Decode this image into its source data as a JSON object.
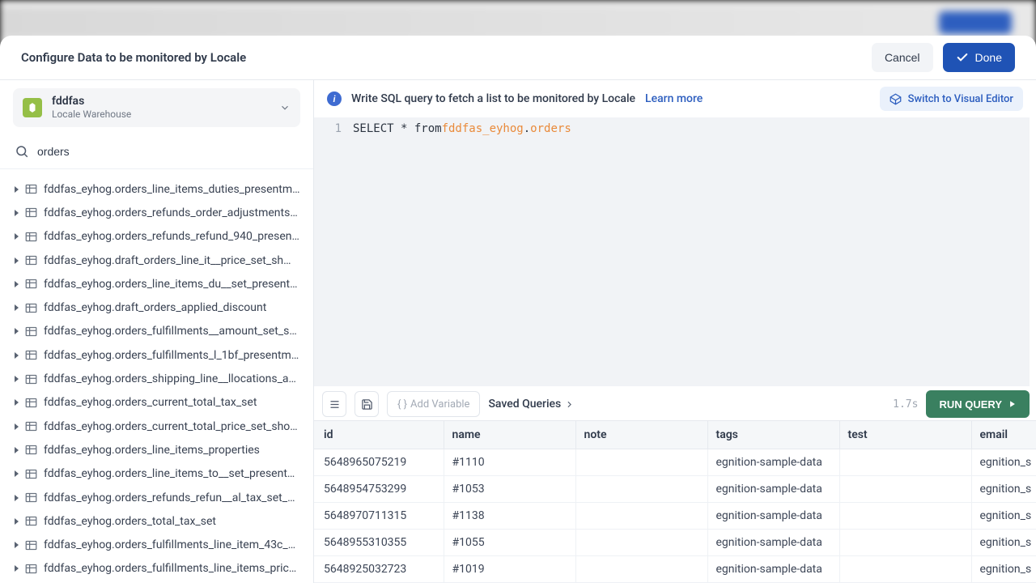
{
  "modal": {
    "title": "Configure Data to be monitored by Locale",
    "cancel": "Cancel",
    "done": "Done"
  },
  "source": {
    "name": "fddfas",
    "subtitle": "Locale Warehouse"
  },
  "search": {
    "value": "orders"
  },
  "tables": [
    "fddfas_eyhog.orders_line_items_duties_presentm…",
    "fddfas_eyhog.orders_refunds_order_adjustments…",
    "fddfas_eyhog.orders_refunds_refund_940_presen…",
    "fddfas_eyhog.draft_orders_line_it__price_set_sh…",
    "fddfas_eyhog.orders_line_items_du__set_present…",
    "fddfas_eyhog.draft_orders_applied_discount",
    "fddfas_eyhog.orders_fulfillments__amount_set_s…",
    "fddfas_eyhog.orders_fulfillments_l_1bf_presentme…",
    "fddfas_eyhog.orders_shipping_line__llocations_a…",
    "fddfas_eyhog.orders_current_total_tax_set",
    "fddfas_eyhog.orders_current_total_price_set_sho…",
    "fddfas_eyhog.orders_line_items_properties",
    "fddfas_eyhog.orders_line_items_to__set_present…",
    "fddfas_eyhog.orders_refunds_refun__al_tax_set_s…",
    "fddfas_eyhog.orders_total_tax_set",
    "fddfas_eyhog.orders_fulfillments_line_item_43c_p…",
    "fddfas_eyhog.orders_fulfillments_line_items_price…"
  ],
  "prompt": {
    "text": "Write SQL query to fetch a list to be monitored by Locale",
    "learn_more": "Learn more",
    "switch": "Switch to Visual Editor"
  },
  "sql": {
    "line": "1",
    "prefix": "SELECT * from ",
    "schema": "fddfas_eyhog",
    "dot": ".",
    "table": "orders"
  },
  "toolbar": {
    "add_var": "Add Variable",
    "saved": "Saved Queries",
    "timing": "1.7s",
    "run": "RUN QUERY"
  },
  "results": {
    "cols": [
      "id",
      "name",
      "note",
      "tags",
      "test",
      "email"
    ],
    "rows": [
      {
        "id": "5648965075219",
        "name": "#1110",
        "note": "",
        "tags": "egnition-sample-data",
        "test": "",
        "email": "egnition_s"
      },
      {
        "id": "5648954753299",
        "name": "#1053",
        "note": "",
        "tags": "egnition-sample-data",
        "test": "",
        "email": "egnition_s"
      },
      {
        "id": "5648970711315",
        "name": "#1138",
        "note": "",
        "tags": "egnition-sample-data",
        "test": "",
        "email": "egnition_s"
      },
      {
        "id": "5648955310355",
        "name": "#1055",
        "note": "",
        "tags": "egnition-sample-data",
        "test": "",
        "email": "egnition_s"
      },
      {
        "id": "5648925032723",
        "name": "#1019",
        "note": "",
        "tags": "egnition-sample-data",
        "test": "",
        "email": "egnition_s"
      }
    ]
  }
}
